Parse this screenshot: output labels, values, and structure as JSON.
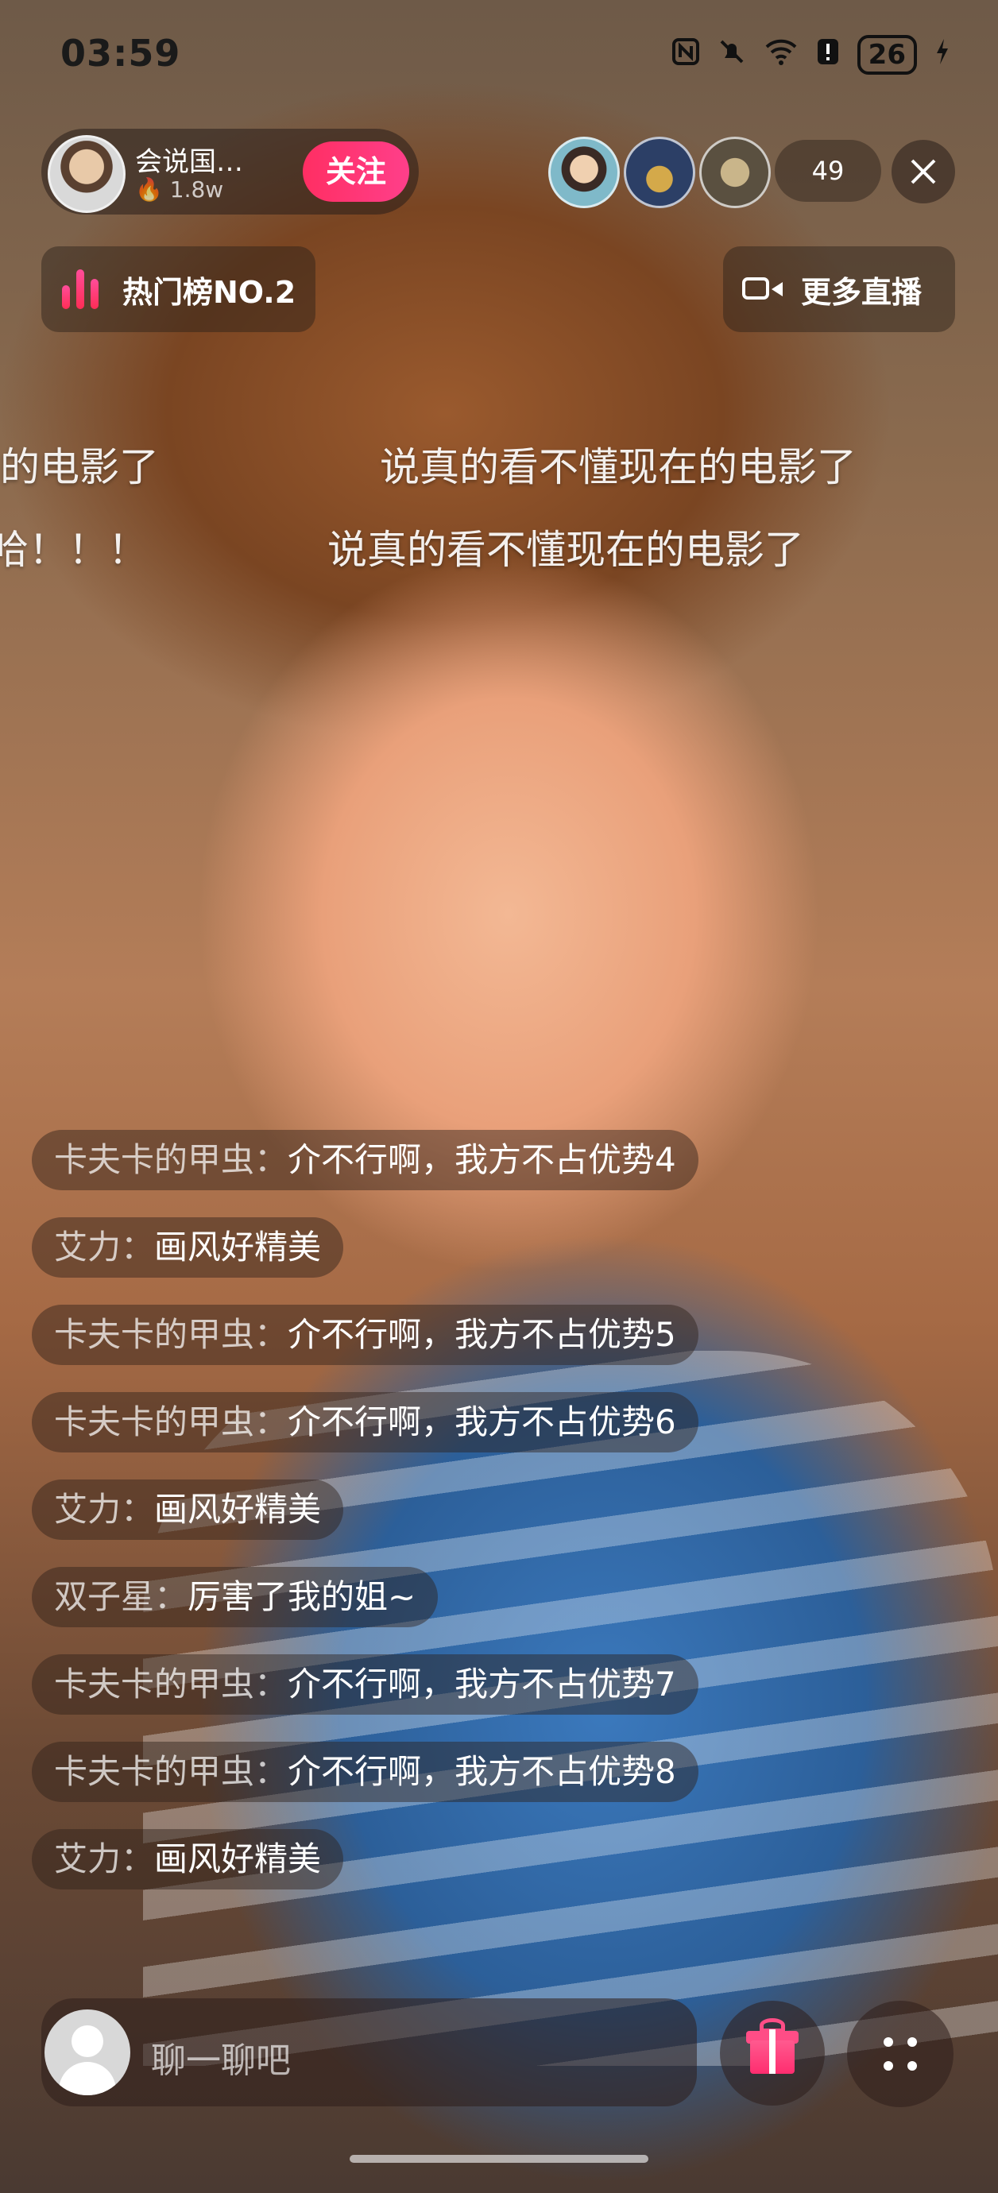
{
  "status_bar": {
    "time": "03:59",
    "battery": "26",
    "icons": [
      "nfc-icon",
      "bell-muted-icon",
      "wifi-6-icon",
      "alert-icon",
      "battery-icon",
      "charging-icon"
    ]
  },
  "anchor": {
    "name": "会说国…",
    "heat": "1.8w",
    "follow_label": "关注"
  },
  "viewers": {
    "count": "49"
  },
  "rank": {
    "label": "热门榜NO.2",
    "accent": "#ff2d6f"
  },
  "more_live": {
    "label": "更多直播"
  },
  "danmaku": [
    "的电影了",
    "说真的看不懂现在的电影了",
    "哈！！！",
    "说真的看不懂现在的电影了"
  ],
  "comments": [
    {
      "user": "卡夫卡的甲虫：",
      "msg": "介不行啊，我方不占优势4"
    },
    {
      "user": "艾力：",
      "msg": "画风好精美"
    },
    {
      "user": "卡夫卡的甲虫：",
      "msg": "介不行啊，我方不占优势5"
    },
    {
      "user": "卡夫卡的甲虫：",
      "msg": "介不行啊，我方不占优势6"
    },
    {
      "user": "艾力：",
      "msg": "画风好精美"
    },
    {
      "user": "双子星：",
      "msg": "厉害了我的姐~"
    },
    {
      "user": "卡夫卡的甲虫：",
      "msg": "介不行啊，我方不占优势7"
    },
    {
      "user": "卡夫卡的甲虫：",
      "msg": "介不行啊，我方不占优势8"
    },
    {
      "user": "艾力：",
      "msg": "画风好精美"
    }
  ],
  "chat": {
    "placeholder": "聊一聊吧"
  }
}
